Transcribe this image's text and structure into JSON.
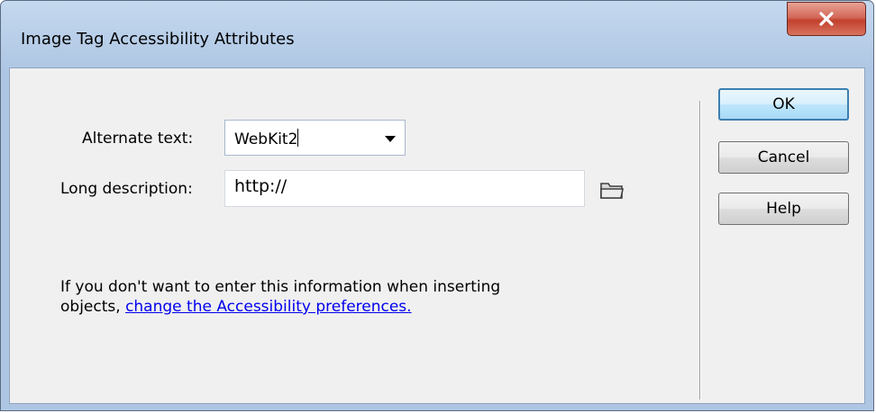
{
  "window": {
    "title": "Image Tag Accessibility Attributes",
    "close_glyph": "x"
  },
  "form": {
    "alt_label": "Alternate text:",
    "alt_value": "WebKit2",
    "long_label": "Long description:",
    "long_value": "http://"
  },
  "note": {
    "text": "If you don't want to enter this information when inserting objects, ",
    "link": "change the Accessibility preferences."
  },
  "buttons": {
    "ok": "OK",
    "cancel": "Cancel",
    "help": "Help"
  },
  "colors": {
    "accent": "#3c7fb1",
    "link": "#0000ee",
    "close": "#c2412e"
  }
}
